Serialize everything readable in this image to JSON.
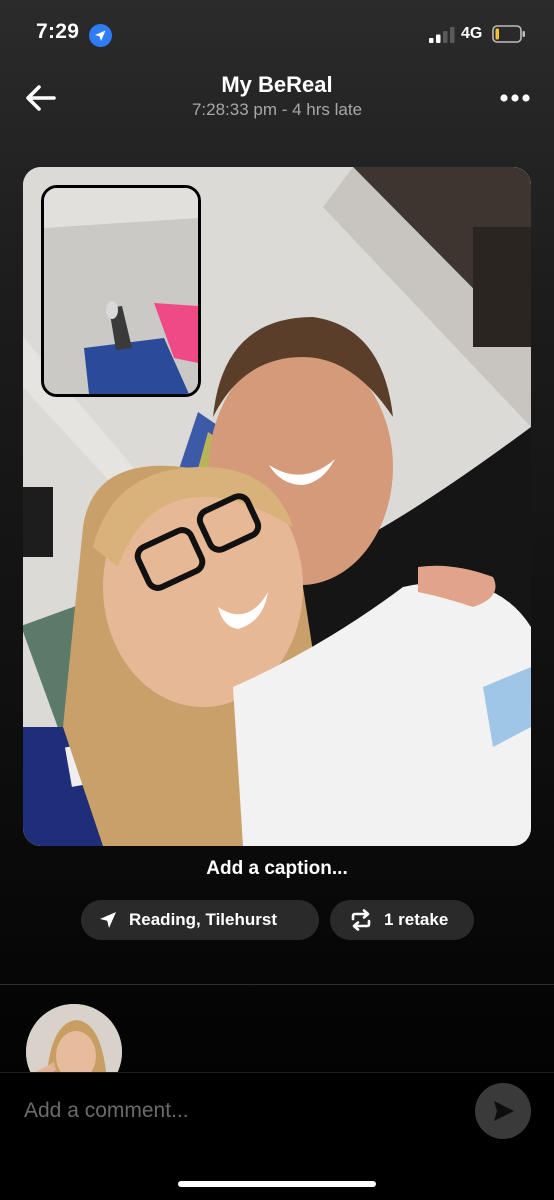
{
  "status_bar": {
    "time": "7:29",
    "network": "4G",
    "location_icon": "location-arrow-icon",
    "signal_icon": "cellular-signal-icon",
    "battery_icon": "battery-low-icon"
  },
  "header": {
    "title": "My BeReal",
    "subtitle": "7:28:33 pm - 4 hrs late",
    "back_icon": "back-arrow-icon",
    "more_icon": "more-dots-icon"
  },
  "post": {
    "caption_placeholder": "Add a caption...",
    "location_label": "Reading, Tilehurst",
    "retake_label": "1 retake",
    "location_icon": "location-arrow-icon",
    "retake_icon": "retake-icon"
  },
  "comment": {
    "placeholder": "Add a comment...",
    "send_icon": "send-icon"
  },
  "colors": {
    "accent_blue": "#2f7cf6",
    "chip_bg": "#2a2a2a",
    "subtitle_gray": "#a8a8a8"
  }
}
